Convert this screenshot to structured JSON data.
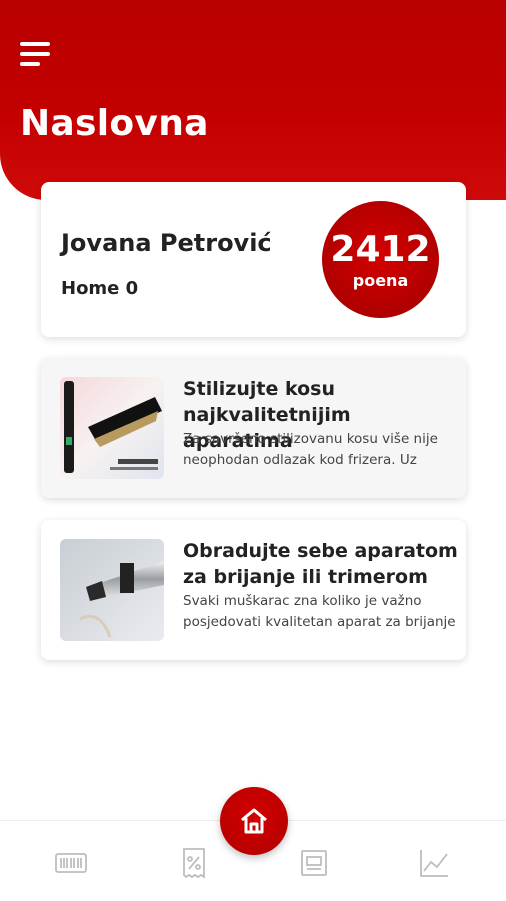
{
  "header": {
    "title": "Naslovna"
  },
  "profile": {
    "name": "Jovana Petrović",
    "subtitle": "Home 0",
    "points": "2412",
    "points_label": "poena"
  },
  "articles": [
    {
      "title": "Stilizujte kosu najkvalitetnijim aparatima",
      "description": "Za savršeno stilizovanu kosu više nije neophodan odlazak kod frizera. Uz"
    },
    {
      "title": "Obradujte sebe aparatom za brijanje ili trimerom",
      "description": "Svaki muškarac zna koliko je važno posjedovati kvalitetan aparat za brijanje"
    }
  ],
  "nav": {
    "items": [
      "barcode-icon",
      "coupon-percent-icon",
      "home-icon",
      "receipt-icon",
      "chart-icon"
    ],
    "active": "home-icon",
    "accent": "#c20000"
  },
  "colors": {
    "brand": "#c20000",
    "text": "#222222"
  }
}
